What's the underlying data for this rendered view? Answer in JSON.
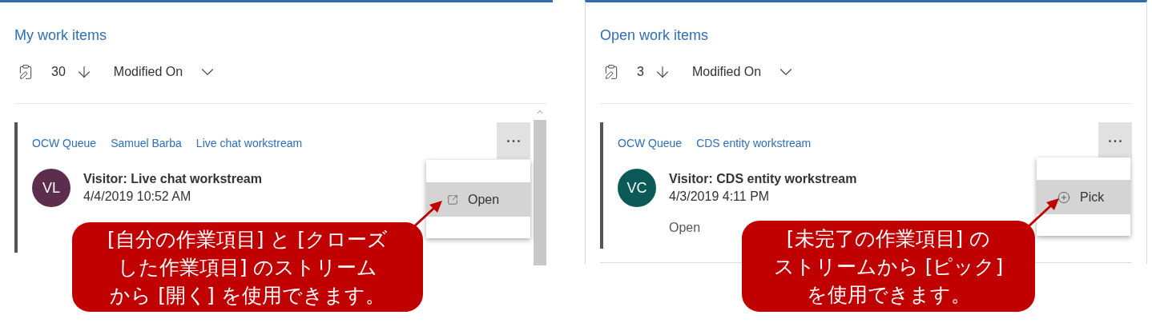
{
  "panels": [
    {
      "title": "My work items",
      "count": "30",
      "sort_field": "Modified On",
      "scrollbar": true,
      "tags": [
        "OCW Queue",
        "Samuel Barba",
        "Live chat workstream"
      ],
      "card": {
        "initials": "VL",
        "color": "#5c2d4d",
        "name": "Visitor: Live chat workstream",
        "date": "4/4/2019 10:52 AM"
      },
      "menu": [
        {
          "kind": "open",
          "label": "Open",
          "selected": true
        }
      ]
    },
    {
      "title": "Open work items",
      "count": "3",
      "sort_field": "Modified On",
      "scrollbar": false,
      "tags": [
        "OCW Queue",
        "CDS entity workstream"
      ],
      "card": {
        "initials": "VC",
        "color": "#0b5a57",
        "name": "Visitor: CDS entity workstream",
        "date": "4/3/2019 4:11 PM",
        "status": "Open"
      },
      "menu": [
        {
          "kind": "pick",
          "label": "Pick",
          "selected": true
        }
      ]
    }
  ],
  "callouts": [
    {
      "lines": [
        "[自分の作業項目] と [クローズ",
        "した作業項目] のストリーム",
        "から [開く] を使用できます。"
      ]
    },
    {
      "lines": [
        "[未完了の作業項目] の",
        "ストリームから [ピック]",
        "を使用できます。"
      ]
    }
  ]
}
